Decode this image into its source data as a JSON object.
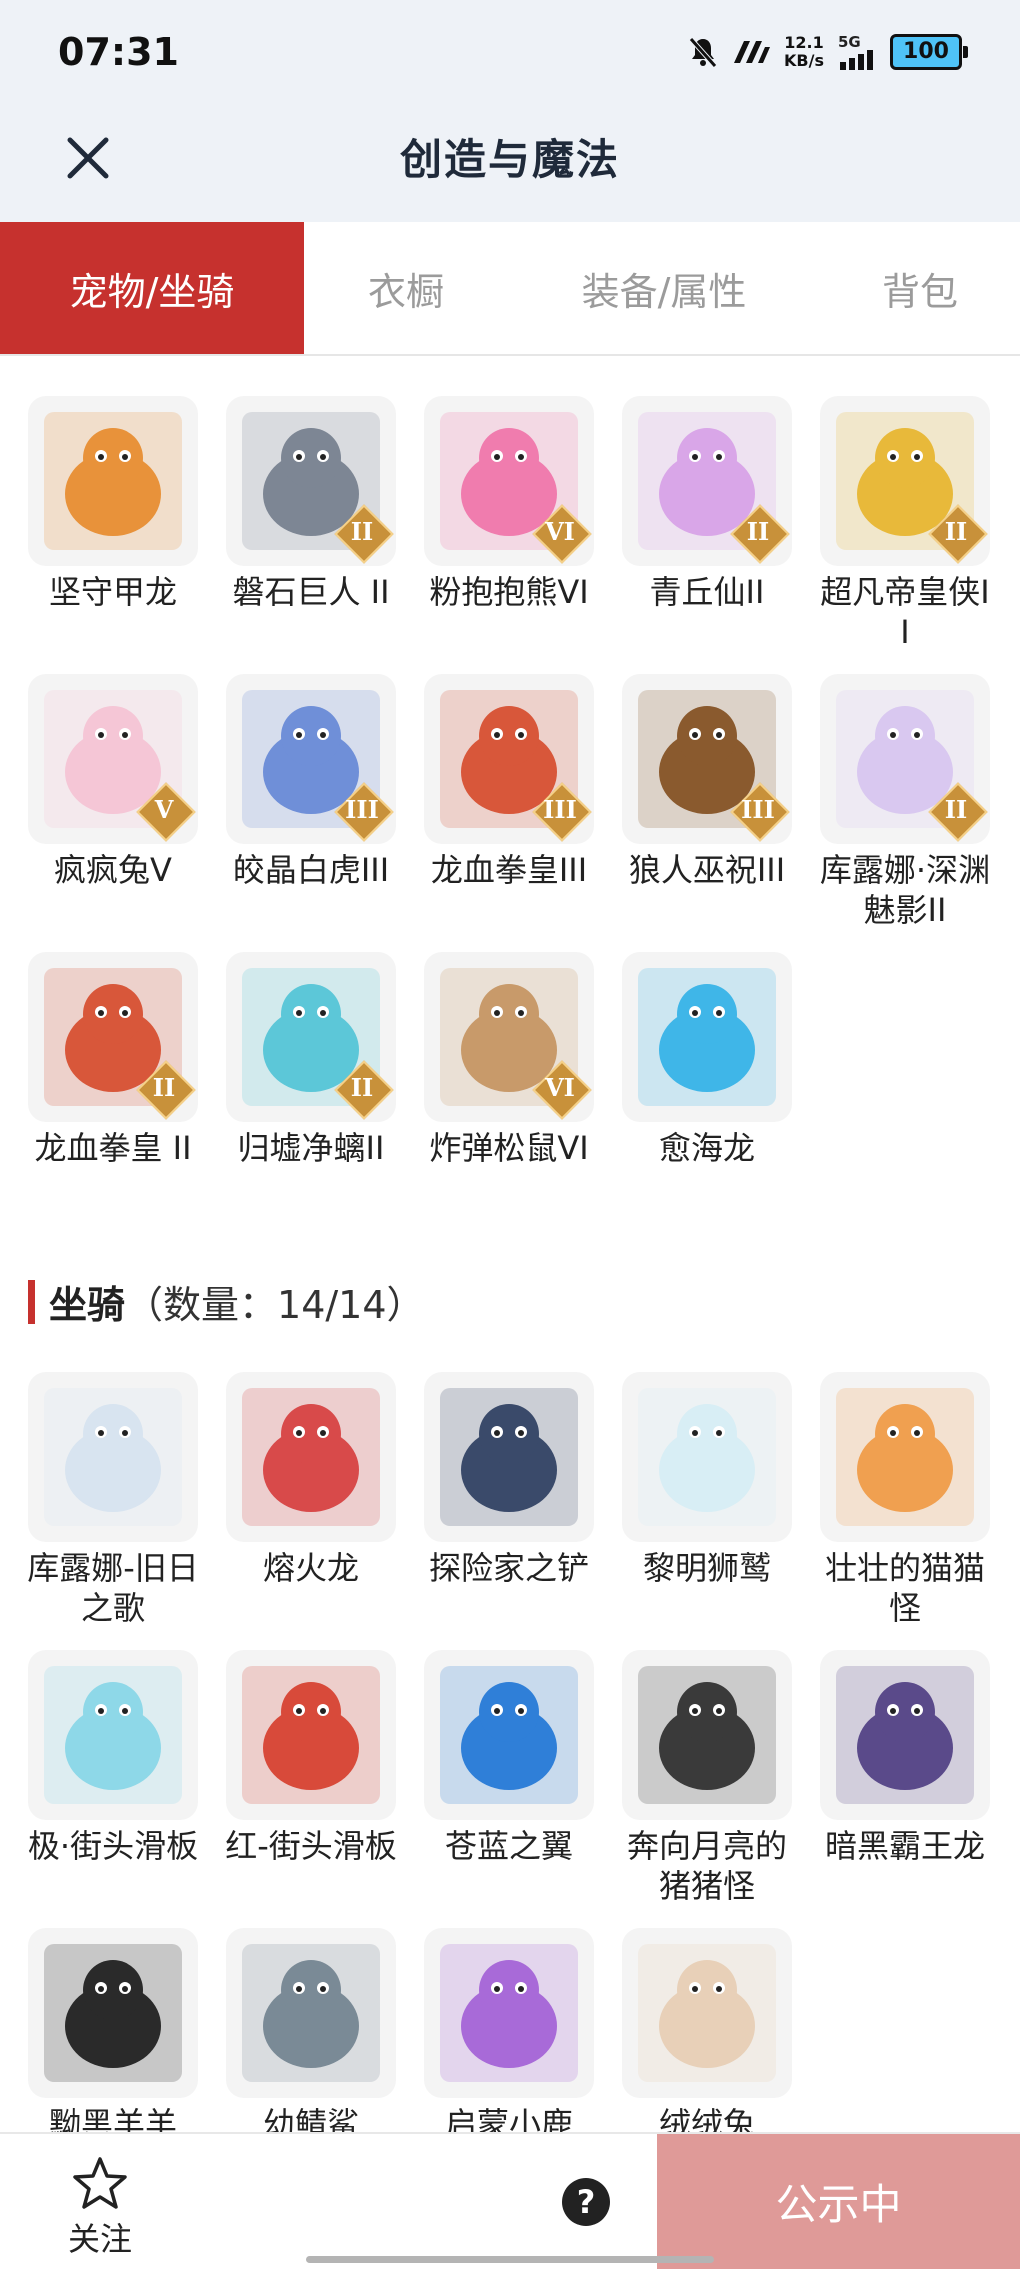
{
  "status_bar": {
    "time": "07:31",
    "net_speed_value": "12.1",
    "net_speed_unit": "KB/s",
    "network": "5G",
    "battery": "100"
  },
  "header": {
    "title": "创造与魔法"
  },
  "tabs": [
    {
      "label": "宠物/坐骑",
      "active": true
    },
    {
      "label": "衣橱",
      "active": false
    },
    {
      "label": "装备/属性",
      "active": false
    },
    {
      "label": "背包",
      "active": false
    }
  ],
  "pets": [
    {
      "name": "坚守甲龙",
      "badge": "",
      "color": "#e8923a",
      "icon": "dragon-icon"
    },
    {
      "name": "磐石巨人 II",
      "badge": "II",
      "color": "#7d8694",
      "icon": "stone-giant-icon"
    },
    {
      "name": "粉抱抱熊VI",
      "badge": "VI",
      "color": "#f07cae",
      "icon": "bear-icon"
    },
    {
      "name": "青丘仙II",
      "badge": "II",
      "color": "#d9a6e8",
      "icon": "fox-fairy-icon"
    },
    {
      "name": "超凡帝皇侠II",
      "badge": "II",
      "color": "#e8b93a",
      "icon": "armor-hero-icon"
    },
    {
      "name": "疯疯兔V",
      "badge": "V",
      "color": "#f5c6d6",
      "icon": "rabbit-icon"
    },
    {
      "name": "皎晶白虎III",
      "badge": "III",
      "color": "#6f8fd8",
      "icon": "white-tiger-icon"
    },
    {
      "name": "龙血拳皇III",
      "badge": "III",
      "color": "#d8573a",
      "icon": "boxer-beast-icon"
    },
    {
      "name": "狼人巫祝III",
      "badge": "III",
      "color": "#8a5a2e",
      "icon": "werewolf-icon"
    },
    {
      "name": "库露娜·深渊魅影II",
      "badge": "II",
      "color": "#d9c8f0",
      "icon": "abyss-girl-icon"
    },
    {
      "name": "龙血拳皇 II",
      "badge": "II",
      "color": "#d8573a",
      "icon": "boxer-beast-icon"
    },
    {
      "name": "归墟净螭II",
      "badge": "II",
      "color": "#5cc7d8",
      "icon": "water-dragon-icon"
    },
    {
      "name": "炸弹松鼠VI",
      "badge": "VI",
      "color": "#c89a6a",
      "icon": "squirrel-icon"
    },
    {
      "name": "愈海龙",
      "badge": "",
      "color": "#3fb6e8",
      "icon": "sea-dragon-icon"
    }
  ],
  "mount_section": {
    "title": "坐骑",
    "count_text": "（数量：14/14）"
  },
  "mounts": [
    {
      "name": "库露娜-旧日之歌",
      "badge": "",
      "color": "#d8e4f0",
      "icon": "girl-mount-icon"
    },
    {
      "name": "熔火龙",
      "badge": "",
      "color": "#d84a4a",
      "icon": "lava-dragon-icon"
    },
    {
      "name": "探险家之铲",
      "badge": "",
      "color": "#3a4a6a",
      "icon": "shovel-icon"
    },
    {
      "name": "黎明狮鹫",
      "badge": "",
      "color": "#d8eef5",
      "icon": "griffin-icon"
    },
    {
      "name": "壮壮的猫猫怪",
      "badge": "",
      "color": "#f0a050",
      "icon": "cat-icon"
    },
    {
      "name": "极·街头滑板",
      "badge": "",
      "color": "#8ed8e8",
      "icon": "skateboard-icon"
    },
    {
      "name": "红-街头滑板",
      "badge": "",
      "color": "#d84a3a",
      "icon": "skateboard-icon"
    },
    {
      "name": "苍蓝之翼",
      "badge": "",
      "color": "#2f7fd8",
      "icon": "blue-wing-icon"
    },
    {
      "name": "奔向月亮的猪猪怪",
      "badge": "",
      "color": "#3a3a3a",
      "icon": "pig-icon"
    },
    {
      "name": "暗黑霸王龙",
      "badge": "",
      "color": "#5a4a8a",
      "icon": "dark-trex-icon"
    },
    {
      "name": "黝黑羊羊",
      "badge": "",
      "color": "#2a2a2a",
      "icon": "black-sheep-icon"
    },
    {
      "name": "幼鲭鲨",
      "badge": "",
      "color": "#7a8a96",
      "icon": "shark-icon"
    },
    {
      "name": "启蒙小鹿",
      "badge": "",
      "color": "#a86ad8",
      "icon": "deer-icon"
    },
    {
      "name": "绒绒兔",
      "badge": "",
      "color": "#e8d0b8",
      "icon": "fluffy-rabbit-icon"
    }
  ],
  "bottom_bar": {
    "follow_label": "关注",
    "help_symbol": "?",
    "status_button": "公示中"
  }
}
